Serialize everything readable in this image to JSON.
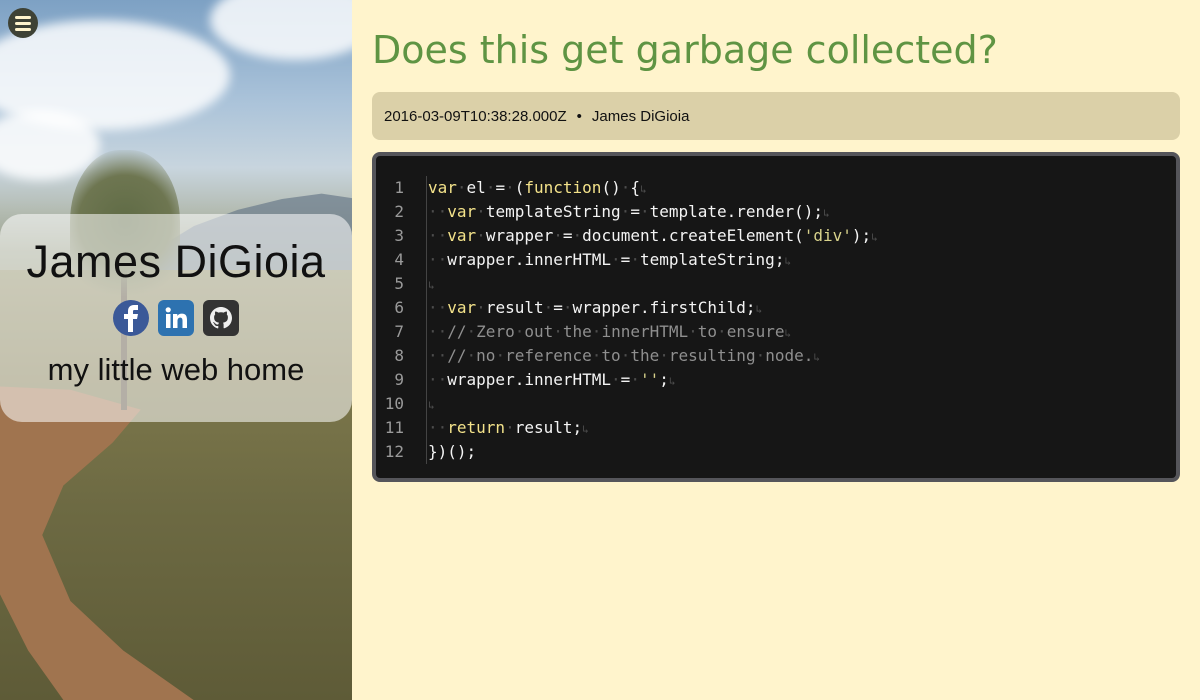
{
  "sidebar": {
    "author_name": "James DiGioia",
    "tagline": "my little web home",
    "socials": [
      {
        "name": "facebook",
        "icon": "facebook-icon"
      },
      {
        "name": "linkedin",
        "icon": "linkedin-icon"
      },
      {
        "name": "github",
        "icon": "github-icon"
      }
    ]
  },
  "post": {
    "title": "Does this get garbage collected?",
    "date": "2016-03-09T10:38:28.000Z",
    "separator": "•",
    "author": "James DiGioia",
    "code_lines": [
      "var el = (function() {",
      "  var templateString = template.render();",
      "  var wrapper = document.createElement('div');",
      "  wrapper.innerHTML = templateString;",
      "",
      "  var result = wrapper.firstChild;",
      "  // Zero out the innerHTML to ensure",
      "  // no reference to the resulting node.",
      "  wrapper.innerHTML = '';",
      "",
      "  return result;",
      "})();"
    ]
  },
  "colors": {
    "page_background": "#fff4cc",
    "title": "#5f9443",
    "meta_background": "#dbd0a8",
    "code_background": "#161616",
    "keyword": "#f3e28a"
  }
}
